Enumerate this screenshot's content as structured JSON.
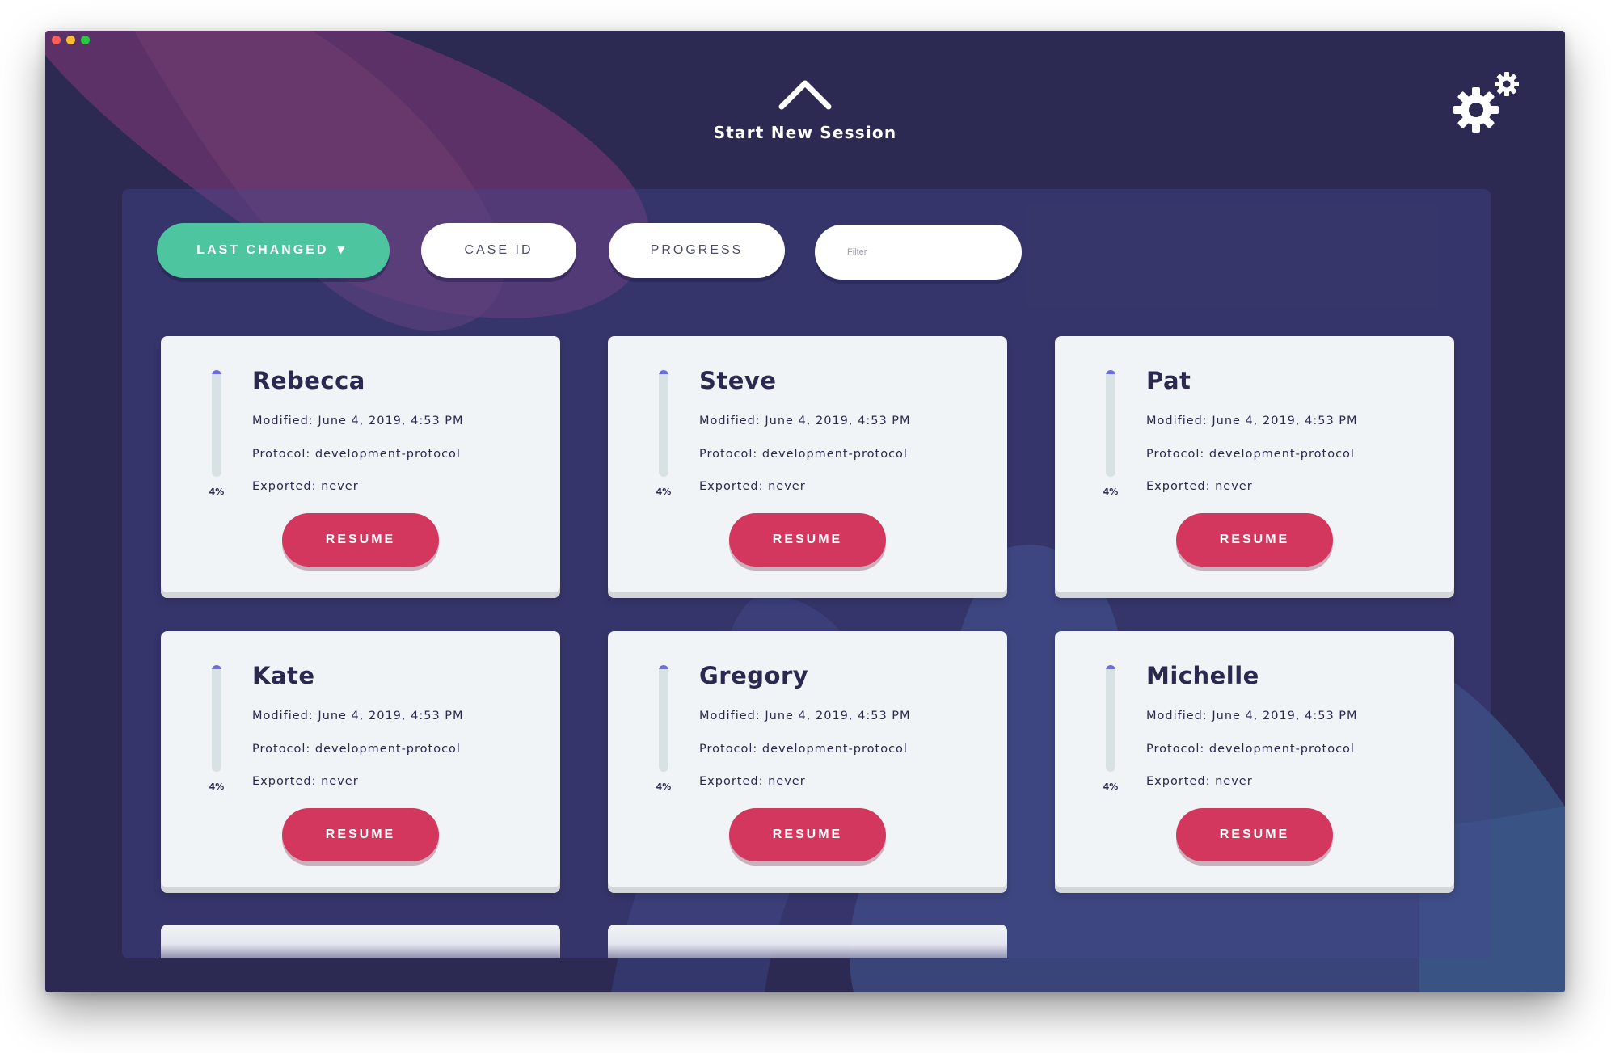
{
  "window_controls": [
    "close",
    "minimize",
    "zoom"
  ],
  "header": {
    "start_icon": "chevron-up-icon",
    "start_label": "Start New Session",
    "settings_icon": "gear-icon"
  },
  "sort": {
    "last_changed_label": "LAST CHANGED ▼",
    "case_id_label": "CASE ID",
    "progress_label": "PROGRESS",
    "filter_placeholder": "Filter"
  },
  "colors": {
    "window_bg": "#2c2953",
    "accent_green": "#4dc6a0",
    "resume_red": "#d3375e",
    "progress_fill": "#6c6ce0"
  },
  "cards": [
    {
      "name": "Rebecca",
      "modified": "Modified: June 4, 2019, 4:53 PM",
      "protocol": "Protocol: development-protocol",
      "exported": "Exported: never",
      "progress_label": "4%",
      "progress": 4,
      "resume_label": "RESUME"
    },
    {
      "name": "Steve",
      "modified": "Modified: June 4, 2019, 4:53 PM",
      "protocol": "Protocol: development-protocol",
      "exported": "Exported: never",
      "progress_label": "4%",
      "progress": 4,
      "resume_label": "RESUME"
    },
    {
      "name": "Pat",
      "modified": "Modified: June 4, 2019, 4:53 PM",
      "protocol": "Protocol: development-protocol",
      "exported": "Exported: never",
      "progress_label": "4%",
      "progress": 4,
      "resume_label": "RESUME"
    },
    {
      "name": "Kate",
      "modified": "Modified: June 4, 2019, 4:53 PM",
      "protocol": "Protocol: development-protocol",
      "exported": "Exported: never",
      "progress_label": "4%",
      "progress": 4,
      "resume_label": "RESUME"
    },
    {
      "name": "Gregory",
      "modified": "Modified: June 4, 2019, 4:53 PM",
      "protocol": "Protocol: development-protocol",
      "exported": "Exported: never",
      "progress_label": "4%",
      "progress": 4,
      "resume_label": "RESUME"
    },
    {
      "name": "Michelle",
      "modified": "Modified: June 4, 2019, 4:53 PM",
      "protocol": "Protocol: development-protocol",
      "exported": "Exported: never",
      "progress_label": "4%",
      "progress": 4,
      "resume_label": "RESUME"
    }
  ]
}
